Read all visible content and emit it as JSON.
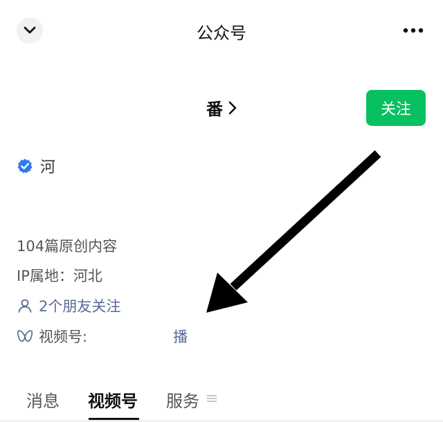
{
  "header": {
    "title": "公众号"
  },
  "account": {
    "name": "番",
    "follow_label": "关注",
    "verified_name": "河"
  },
  "info": {
    "articles": "104篇原创内容",
    "ip_location": "IP属地：河北",
    "friends_following": "2个朋友关注",
    "channel_label": "视频号:",
    "channel_value": "播"
  },
  "tabs": [
    {
      "label": "消息"
    },
    {
      "label": "视频号"
    },
    {
      "label": "服务"
    }
  ],
  "colors": {
    "accent_green": "#07c160",
    "link_blue": "#576b95",
    "verified_blue": "#2b7bf0",
    "annotation_arrow": "#000000"
  },
  "icons": {
    "collapse": "chevron-down-icon",
    "more": "more-dots-icon",
    "name_chevron": "chevron-right-icon",
    "verified": "verified-badge-icon",
    "friends": "person-icon",
    "channel": "channels-butterfly-icon",
    "tab_menu": "menu-lines-icon"
  }
}
